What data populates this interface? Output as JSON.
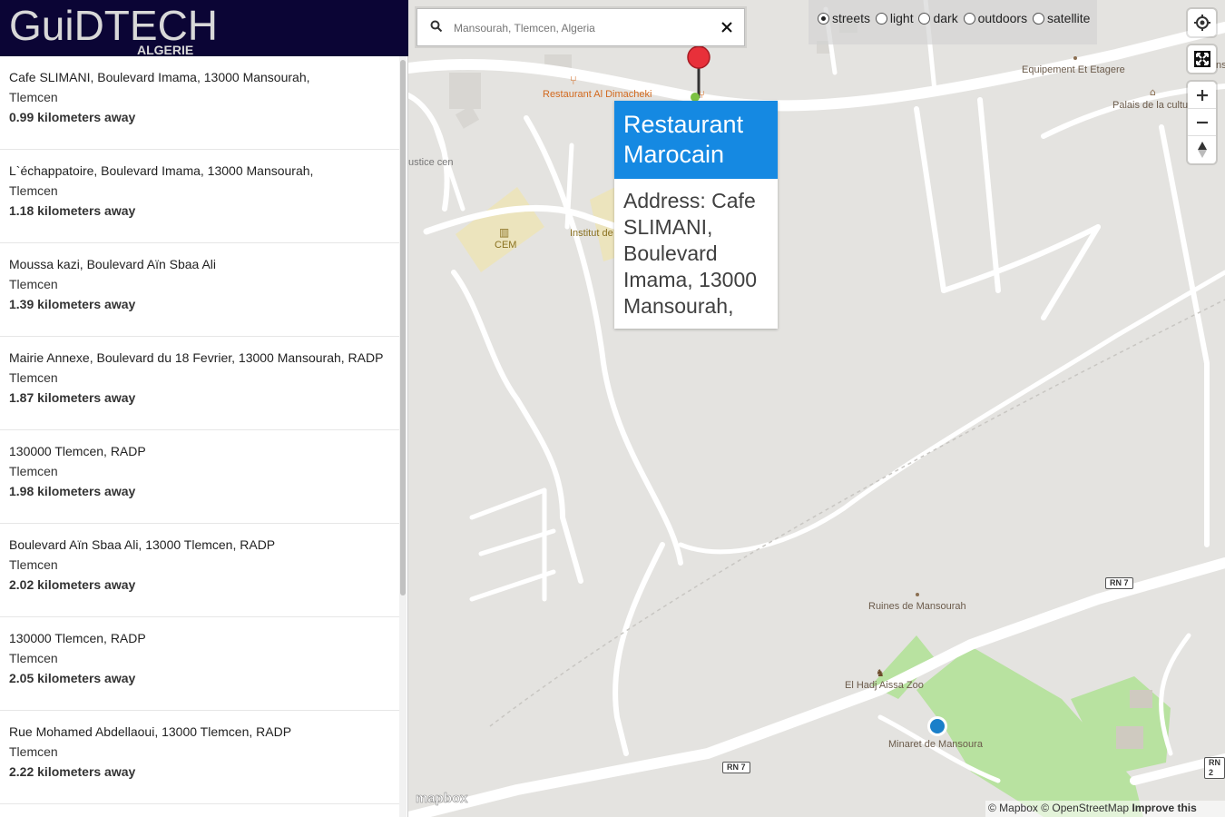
{
  "app": {
    "brand_main": "GuiDTECH",
    "brand_sub": "ALGERIE"
  },
  "results": [
    {
      "address": "Cafe SLIMANI, Boulevard Imama, 13000 Mansourah,",
      "city": "Tlemcen",
      "distance": "0.99 kilometers away"
    },
    {
      "address": "L`échappatoire, Boulevard Imama, 13000 Mansourah,",
      "city": "Tlemcen",
      "distance": "1.18 kilometers away"
    },
    {
      "address": "Moussa kazi, Boulevard Aïn Sbaa Ali",
      "city": "Tlemcen",
      "distance": "1.39 kilometers away"
    },
    {
      "address": "Mairie Annexe, Boulevard du 18 Fevrier, 13000 Mansourah, RADP",
      "city": "Tlemcen",
      "distance": "1.87 kilometers away"
    },
    {
      "address": "130000 Tlemcen, RADP",
      "city": "Tlemcen",
      "distance": "1.98 kilometers away"
    },
    {
      "address": "Boulevard Aïn Sbaa Ali, 13000 Tlemcen, RADP",
      "city": "Tlemcen",
      "distance": "2.02 kilometers away"
    },
    {
      "address": "130000 Tlemcen, RADP",
      "city": "Tlemcen",
      "distance": "2.05 kilometers away"
    },
    {
      "address": "Rue Mohamed Abdellaoui, 13000 Tlemcen, RADP",
      "city": "Tlemcen",
      "distance": "2.22 kilometers away"
    }
  ],
  "search": {
    "placeholder": "Mansourah, Tlemcen, Algeria",
    "value": ""
  },
  "map_styles": {
    "options": [
      "streets",
      "light",
      "dark",
      "outdoors",
      "satellite"
    ],
    "selected": "streets"
  },
  "popup": {
    "title": "Restaurant Marocain",
    "body": "Address: Cafe SLIMANI, Boulevard Imama, 13000 Mansourah,"
  },
  "map_labels": {
    "restaurant": "Restaurant Al Dimacheki",
    "cem": "CEM",
    "institut": "Institut de des i",
    "justice": "ustice cen",
    "equipement": "Equipement Et Etagere",
    "palais": "Palais de la cultu",
    "ns": "ns",
    "ruines": "Ruines de Mansourah",
    "zoo": "El Hadj Aissa Zoo",
    "minaret": "Minaret de Mansoura",
    "rn7_a": "RN 7",
    "rn7_b": "RN 7",
    "rn2": "RN 2"
  },
  "attribution": {
    "mapbox_logo": "mapbox",
    "mapbox": "© Mapbox",
    "osm": "© OpenStreetMap",
    "improve": "Improve this map"
  },
  "colors": {
    "logo_bg": "#0b0535",
    "popup_header": "#1589e2",
    "pin": "#e8303a",
    "user_location": "#1a7fc9",
    "park": "#b8e2a0",
    "school": "#ece4bd",
    "map_bg": "#e4e3e0"
  }
}
